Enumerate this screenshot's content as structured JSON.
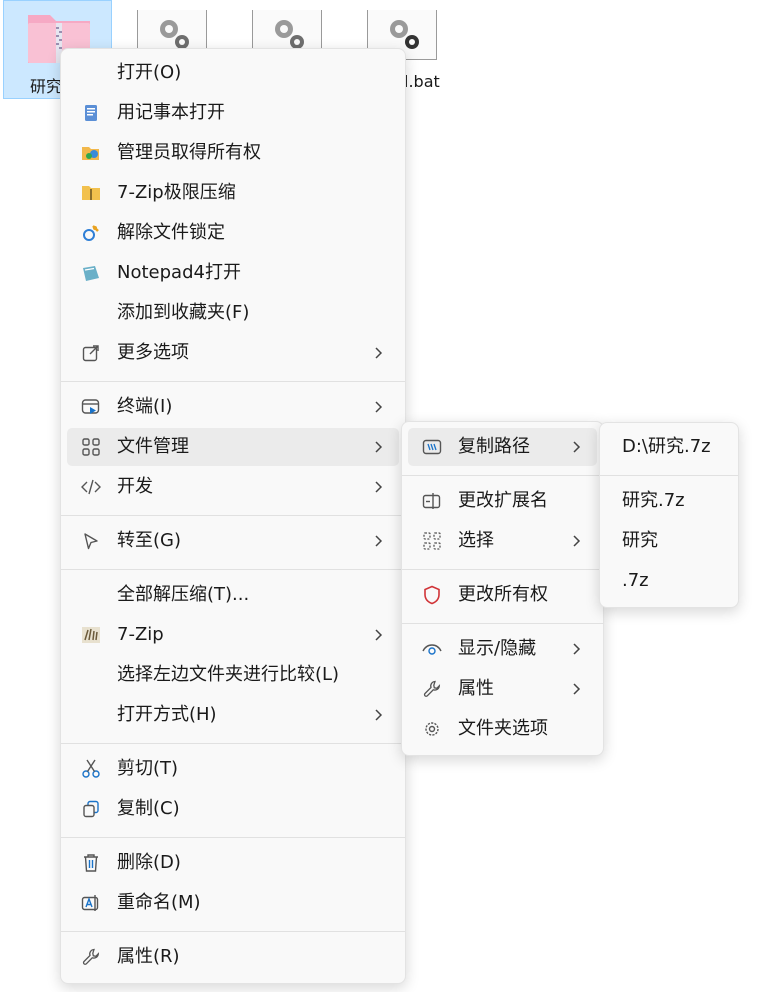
{
  "desktop": {
    "selected_file_label": "研究",
    "bat_file_label": "l.bat"
  },
  "context_menu": {
    "items": [
      {
        "label": "打开(O)"
      },
      {
        "label": "用记事本打开",
        "icon": "notepad-icon"
      },
      {
        "label": "管理员取得所有权",
        "icon": "admin-ownership-icon"
      },
      {
        "label": "7-Zip极限压缩",
        "icon": "zip-archive-icon"
      },
      {
        "label": "解除文件锁定",
        "icon": "unlock-icon"
      },
      {
        "label": "Notepad4打开",
        "icon": "notepad4-icon"
      },
      {
        "label": "添加到收藏夹(F)"
      },
      {
        "label": "更多选项",
        "icon": "share-icon"
      },
      {
        "label": "终端(I)",
        "icon": "terminal-icon"
      },
      {
        "label": "文件管理",
        "icon": "grid-icon"
      },
      {
        "label": "开发",
        "icon": "code-icon"
      },
      {
        "label": "转至(G)",
        "icon": "cursor-icon"
      },
      {
        "label": "全部解压缩(T)..."
      },
      {
        "label": "7-Zip",
        "icon": "7zip-icon"
      },
      {
        "label": "选择左边文件夹进行比较(L)"
      },
      {
        "label": "打开方式(H)"
      },
      {
        "label": "剪切(T)",
        "icon": "scissors-icon"
      },
      {
        "label": "复制(C)",
        "icon": "copy-icon"
      },
      {
        "label": "删除(D)",
        "icon": "trash-icon"
      },
      {
        "label": "重命名(M)",
        "icon": "rename-icon"
      },
      {
        "label": "属性(R)",
        "icon": "wrench-icon"
      }
    ]
  },
  "file_management_menu": {
    "items": [
      {
        "label": "复制路径",
        "icon": "path-icon"
      },
      {
        "label": "更改扩展名",
        "icon": "rename-ext-icon"
      },
      {
        "label": "选择",
        "icon": "select-icon"
      },
      {
        "label": "更改所有权",
        "icon": "shield-icon"
      },
      {
        "label": "显示/隐藏",
        "icon": "eye-icon"
      },
      {
        "label": "属性",
        "icon": "wrench-icon"
      },
      {
        "label": "文件夹选项",
        "icon": "gear-icon"
      }
    ]
  },
  "copy_path_menu": {
    "items": [
      {
        "label": "D:\\研究.7z"
      },
      {
        "label": "研究.7z"
      },
      {
        "label": "研究"
      },
      {
        "label": ".7z"
      }
    ]
  },
  "colors": {
    "menu_bg": "#f9f9f9",
    "hover_bg": "#ebebeb",
    "selection_bg": "#cce8ff",
    "accent_blue": "#1a73c9",
    "shield_red": "#d13438"
  }
}
